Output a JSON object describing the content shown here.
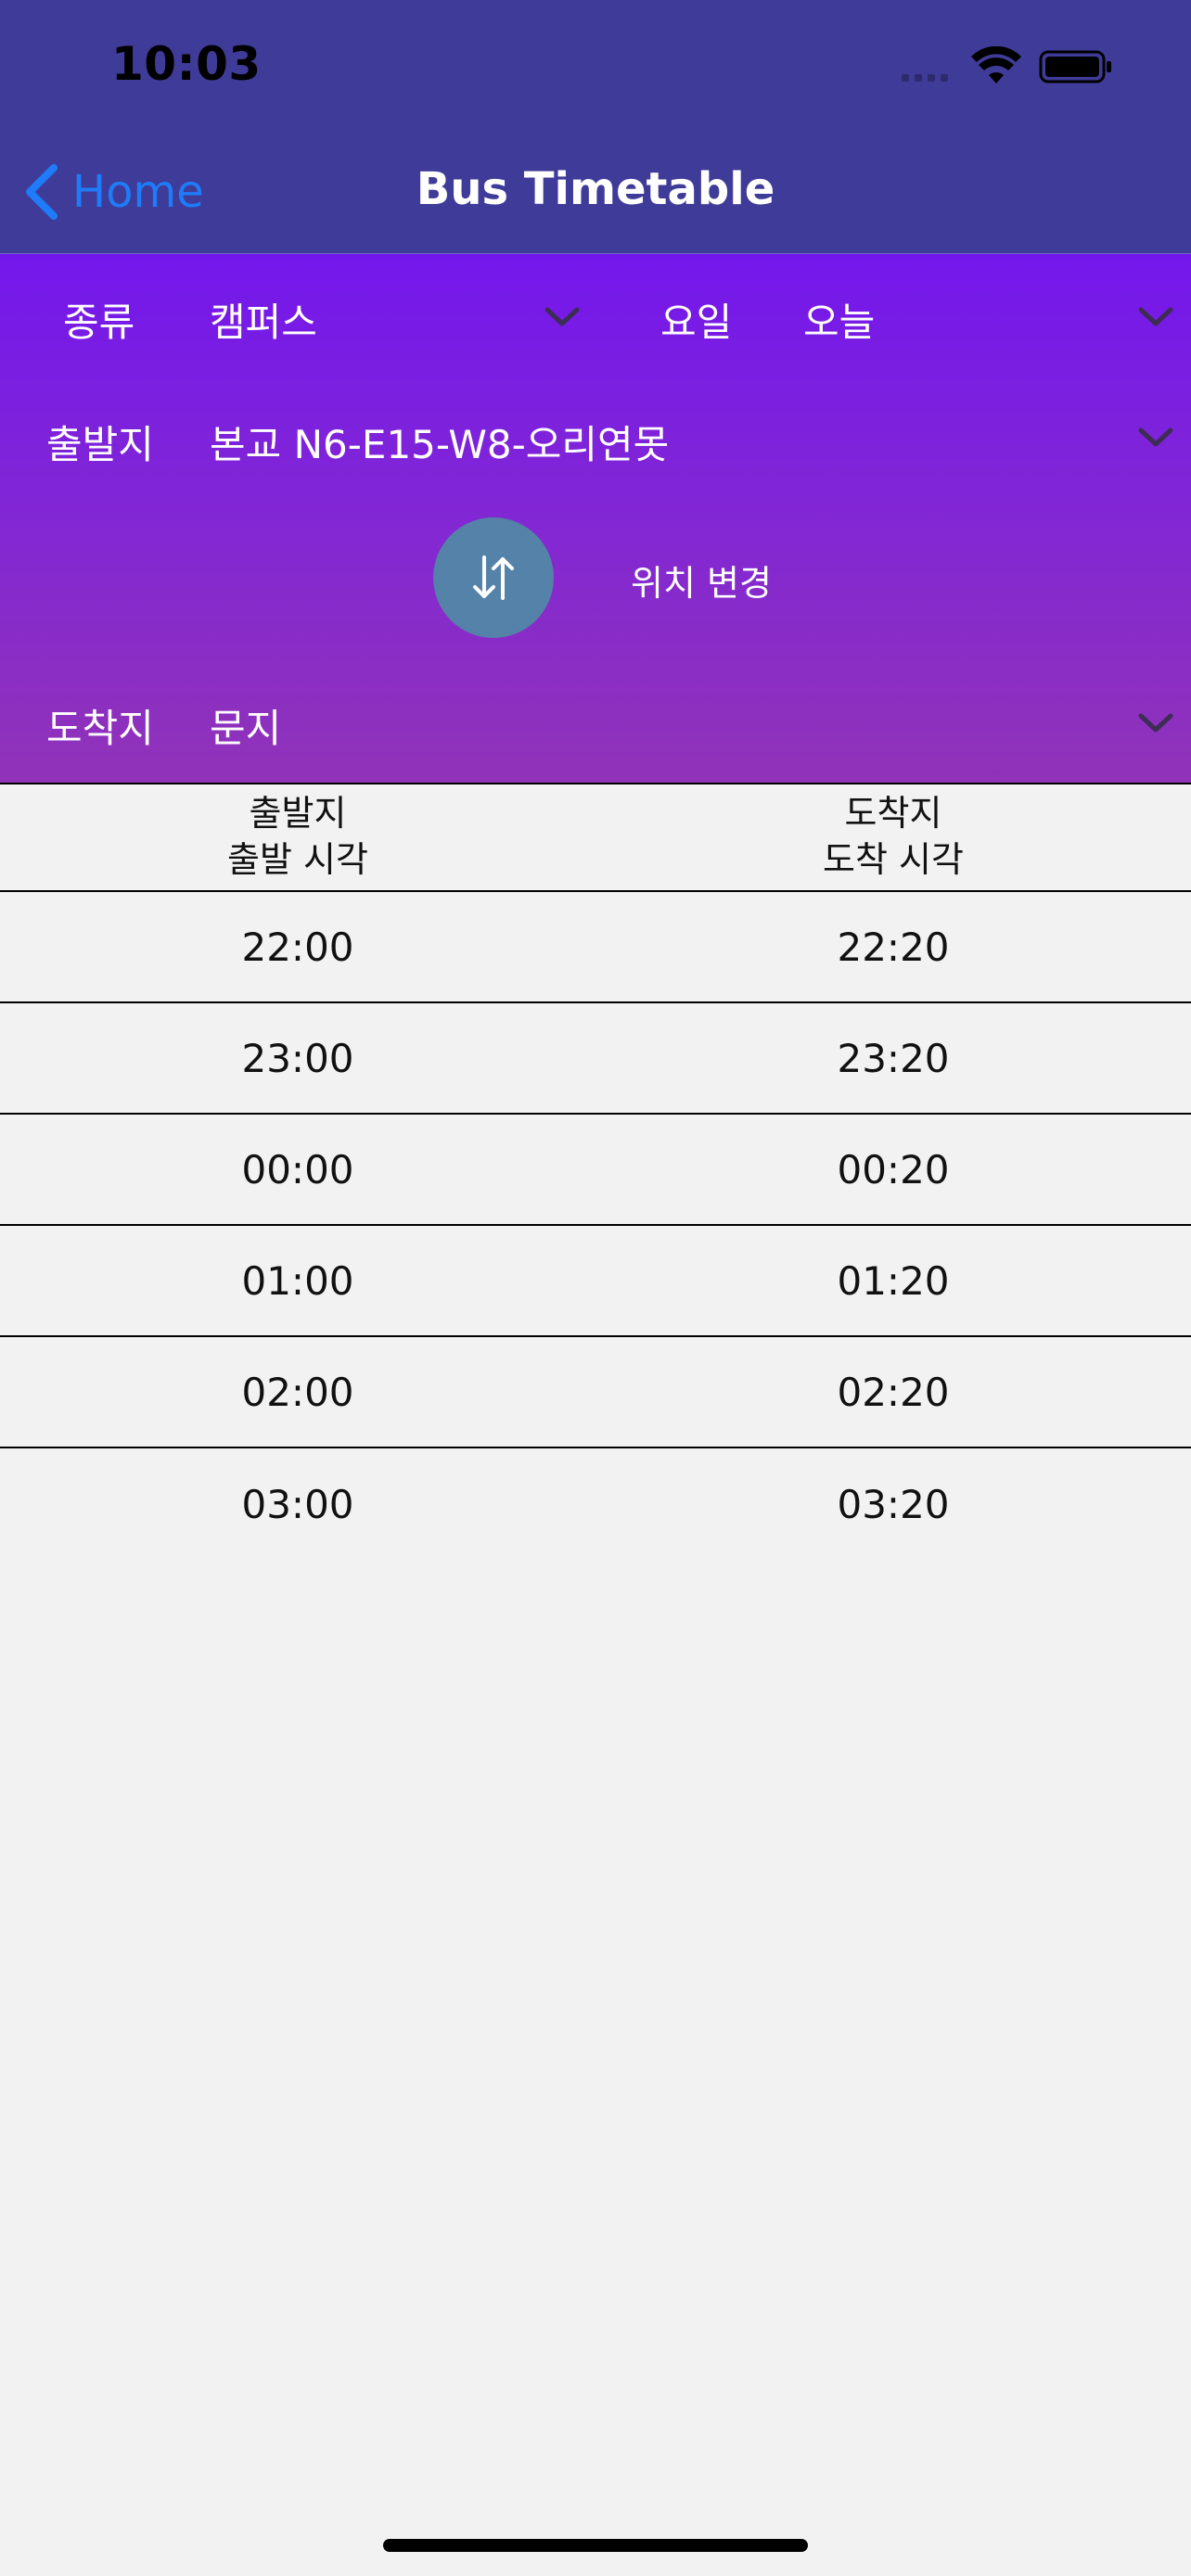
{
  "status_bar": {
    "time": "10:03"
  },
  "nav": {
    "back_label": "Home",
    "title": "Bus Timetable"
  },
  "filters": {
    "type_label": "종류",
    "type_value": "캠퍼스",
    "day_label": "요일",
    "day_value": "오늘",
    "departure_label": "출발지",
    "departure_value": "본교 N6-E15-W8-오리연못",
    "swap_label": "위치 변경",
    "arrival_label": "도착지",
    "arrival_value": "문지"
  },
  "table": {
    "headers": [
      {
        "line1": "출발지",
        "line2": "출발 시각"
      },
      {
        "line1": "도착지",
        "line2": "도착 시각"
      }
    ],
    "rows": [
      [
        "22:00",
        "22:20"
      ],
      [
        "23:00",
        "23:20"
      ],
      [
        "00:00",
        "00:20"
      ],
      [
        "01:00",
        "01:20"
      ],
      [
        "02:00",
        "02:20"
      ],
      [
        "03:00",
        "03:20"
      ]
    ]
  },
  "colors": {
    "nav_bg": "#3f3b98",
    "panel_top": "#7417ec",
    "panel_bottom": "#9133b8",
    "back_blue": "#1e7cf8",
    "swap_button": "#5482a8"
  },
  "icons": [
    "back-chevron-icon",
    "chevron-down-icon",
    "swap-arrows-icon",
    "wifi-icon",
    "battery-icon",
    "cellular-icon"
  ]
}
